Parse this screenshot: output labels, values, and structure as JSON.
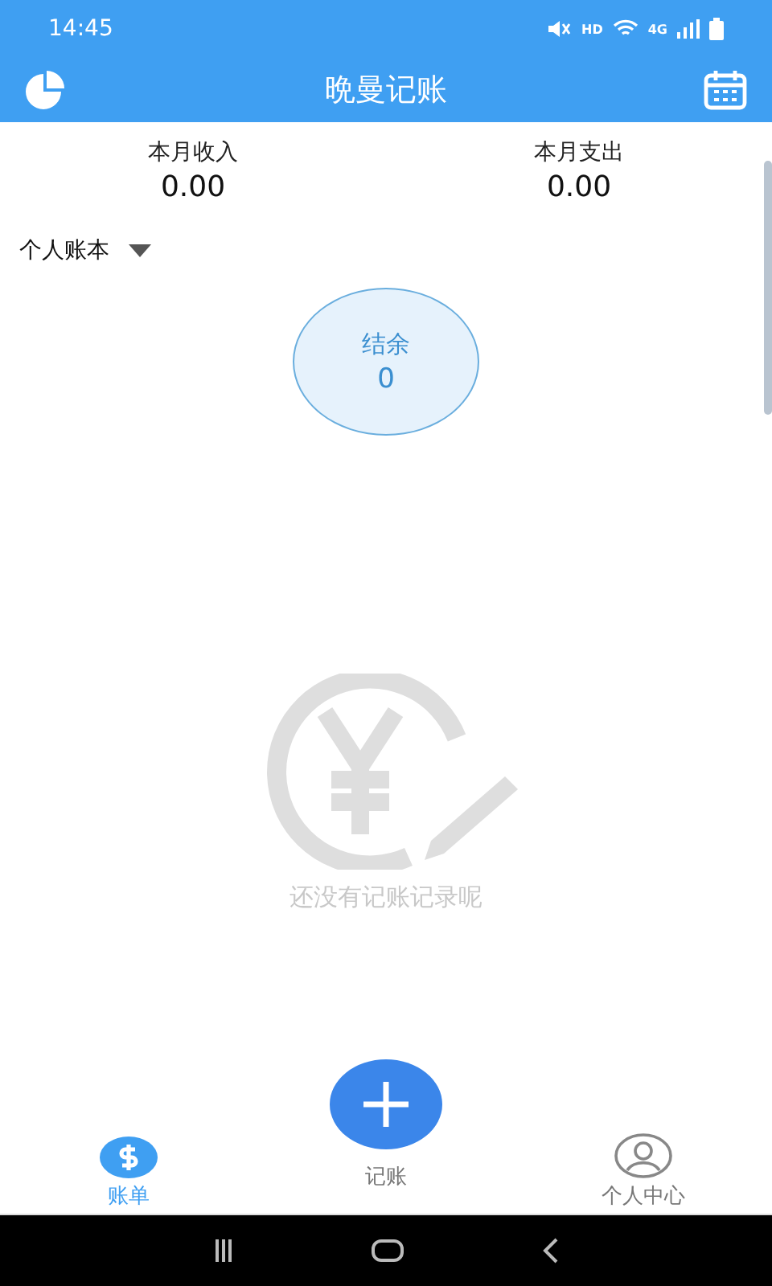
{
  "status_bar": {
    "time": "14:45",
    "network_labels": [
      "HD",
      "4G"
    ]
  },
  "header": {
    "title": "晩曼记账"
  },
  "summary": [
    {
      "label": "本月收入",
      "value": "0.00"
    },
    {
      "label": "本月支出",
      "value": "0.00"
    }
  ],
  "book_selector": {
    "label": "个人账本"
  },
  "balance": {
    "label": "结余",
    "value": "0"
  },
  "empty_state": {
    "message": "还没有记账记录呢"
  },
  "add_button": {
    "label": "记账"
  },
  "tabs": [
    {
      "kind": "bills",
      "label": "账单",
      "selected": true
    },
    {
      "kind": "profile",
      "label": "个人中心",
      "selected": false
    }
  ]
}
